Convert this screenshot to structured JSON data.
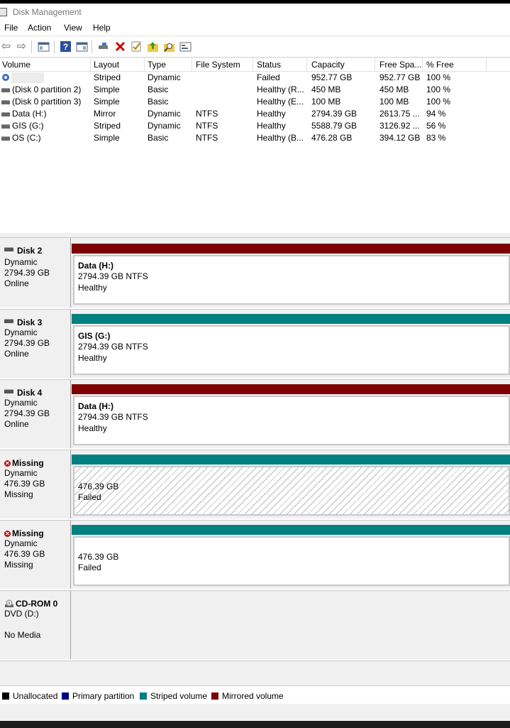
{
  "window": {
    "title": "Disk Management"
  },
  "menu": [
    "File",
    "Action",
    "View",
    "Help"
  ],
  "toolbar": {
    "icons": [
      "back-icon",
      "forward-icon",
      "show-hide-console-tree-icon",
      "help-icon",
      "properties-icon",
      "connect-icon",
      "delete-icon",
      "check-icon",
      "up-folder-icon",
      "search-folder-icon",
      "view-icon"
    ]
  },
  "columns": [
    "Volume",
    "Layout",
    "Type",
    "File System",
    "Status",
    "Capacity",
    "Free Spa...",
    "% Free"
  ],
  "volumes": [
    {
      "volume": "",
      "layout": "Striped",
      "type": "Dynamic",
      "fs": "",
      "status": "Failed",
      "capacity": "952.77 GB",
      "free": "952.77 GB",
      "pct": "100 %"
    },
    {
      "volume": "(Disk 0 partition 2)",
      "layout": "Simple",
      "type": "Basic",
      "fs": "",
      "status": "Healthy (R...",
      "capacity": "450 MB",
      "free": "450 MB",
      "pct": "100 %"
    },
    {
      "volume": "(Disk 0 partition 3)",
      "layout": "Simple",
      "type": "Basic",
      "fs": "",
      "status": "Healthy (E...",
      "capacity": "100 MB",
      "free": "100 MB",
      "pct": "100 %"
    },
    {
      "volume": "Data (H:)",
      "layout": "Mirror",
      "type": "Dynamic",
      "fs": "NTFS",
      "status": "Healthy",
      "capacity": "2794.39 GB",
      "free": "2613.75 ...",
      "pct": "94 %"
    },
    {
      "volume": "GIS (G:)",
      "layout": "Striped",
      "type": "Dynamic",
      "fs": "NTFS",
      "status": "Healthy",
      "capacity": "5588.79 GB",
      "free": "3126.92 ...",
      "pct": "56 %"
    },
    {
      "volume": "OS (C:)",
      "layout": "Simple",
      "type": "Basic",
      "fs": "NTFS",
      "status": "Healthy (B...",
      "capacity": "476.28 GB",
      "free": "394.12 GB",
      "pct": "83 %"
    }
  ],
  "disks": [
    {
      "name": "Disk 2",
      "kind": "Dynamic",
      "size": "2794.39 GB",
      "state": "Online",
      "bar_color": "#7f0000",
      "vol_name": "Data  (H:)",
      "vol_line1": "2794.39 GB NTFS",
      "vol_line2": "Healthy"
    },
    {
      "name": "Disk 3",
      "kind": "Dynamic",
      "size": "2794.39 GB",
      "state": "Online",
      "bar_color": "#008080",
      "vol_name": "GIS  (G:)",
      "vol_line1": "2794.39 GB NTFS",
      "vol_line2": "Healthy"
    },
    {
      "name": "Disk 4",
      "kind": "Dynamic",
      "size": "2794.39 GB",
      "state": "Online",
      "bar_color": "#7f0000",
      "vol_name": "Data  (H:)",
      "vol_line1": "2794.39 GB NTFS",
      "vol_line2": "Healthy"
    },
    {
      "name": "Missing",
      "kind": "Dynamic",
      "size": "476.39 GB",
      "state": "Missing",
      "bar_color": "#008080",
      "vol_name": "",
      "vol_line1": "476.39 GB",
      "vol_line2": "Failed"
    },
    {
      "name": "Missing",
      "kind": "Dynamic",
      "size": "476.39 GB",
      "state": "Missing",
      "bar_color": "#008080",
      "vol_name": "",
      "vol_line1": "476.39 GB",
      "vol_line2": "Failed"
    }
  ],
  "cdrom": {
    "name": "CD-ROM 0",
    "kind": "DVD (D:)",
    "state": "No Media"
  },
  "legend": [
    {
      "label": "Unallocated",
      "color": "#000000"
    },
    {
      "label": "Primary partition",
      "color": "#000080"
    },
    {
      "label": "Striped volume",
      "color": "#008080"
    },
    {
      "label": "Mirrored volume",
      "color": "#7f0000"
    }
  ]
}
